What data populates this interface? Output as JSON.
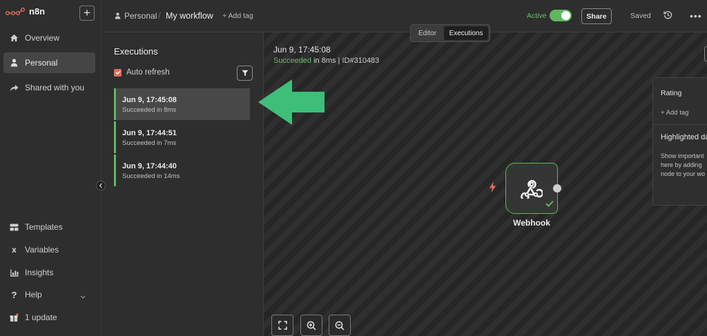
{
  "app": {
    "name": "n8n",
    "add_label": "+"
  },
  "sidebar": {
    "top_items": [
      {
        "label": "Overview",
        "icon": "home-icon"
      },
      {
        "label": "Personal",
        "icon": "user-icon",
        "active": true
      },
      {
        "label": "Shared with you",
        "icon": "share-icon"
      }
    ],
    "bottom_items": [
      {
        "label": "Templates",
        "icon": "templates-icon"
      },
      {
        "label": "Variables",
        "icon": "variables-icon"
      },
      {
        "label": "Insights",
        "icon": "insights-icon"
      },
      {
        "label": "Help",
        "icon": "help-icon"
      },
      {
        "label": "1 update",
        "icon": "gift-icon"
      }
    ]
  },
  "header": {
    "project": "Personal",
    "separator": "/",
    "workflow_title": "My workflow",
    "add_tag": "+ Add tag",
    "active_label": "Active",
    "share_label": "Share",
    "saved_label": "Saved",
    "more_label": "•••"
  },
  "tabs": {
    "editor": "Editor",
    "executions": "Executions"
  },
  "executions": {
    "title": "Executions",
    "auto_refresh": "Auto refresh",
    "items": [
      {
        "date": "Jun 9, 17:45:08",
        "status": "Succeeded in 8ms",
        "selected": true
      },
      {
        "date": "Jun 9, 17:44:51",
        "status": "Succeeded in 7ms"
      },
      {
        "date": "Jun 9, 17:44:40",
        "status": "Succeeded in 14ms"
      }
    ]
  },
  "canvas": {
    "date": "Jun 9, 17:45:08",
    "status_ok": "Succeeded",
    "status_rest": " in 8ms | ID#310483",
    "node_label": "Webhook"
  },
  "side_card": {
    "rating": "Rating",
    "add_tag": "+ Add tag",
    "heading": "Highlighted da",
    "body": [
      "Show important",
      "here by adding",
      "node to your wo"
    ]
  },
  "colors": {
    "success": "#5cb85c",
    "accent_arrow": "#3dbf7a",
    "brand": "#e06e5b"
  }
}
